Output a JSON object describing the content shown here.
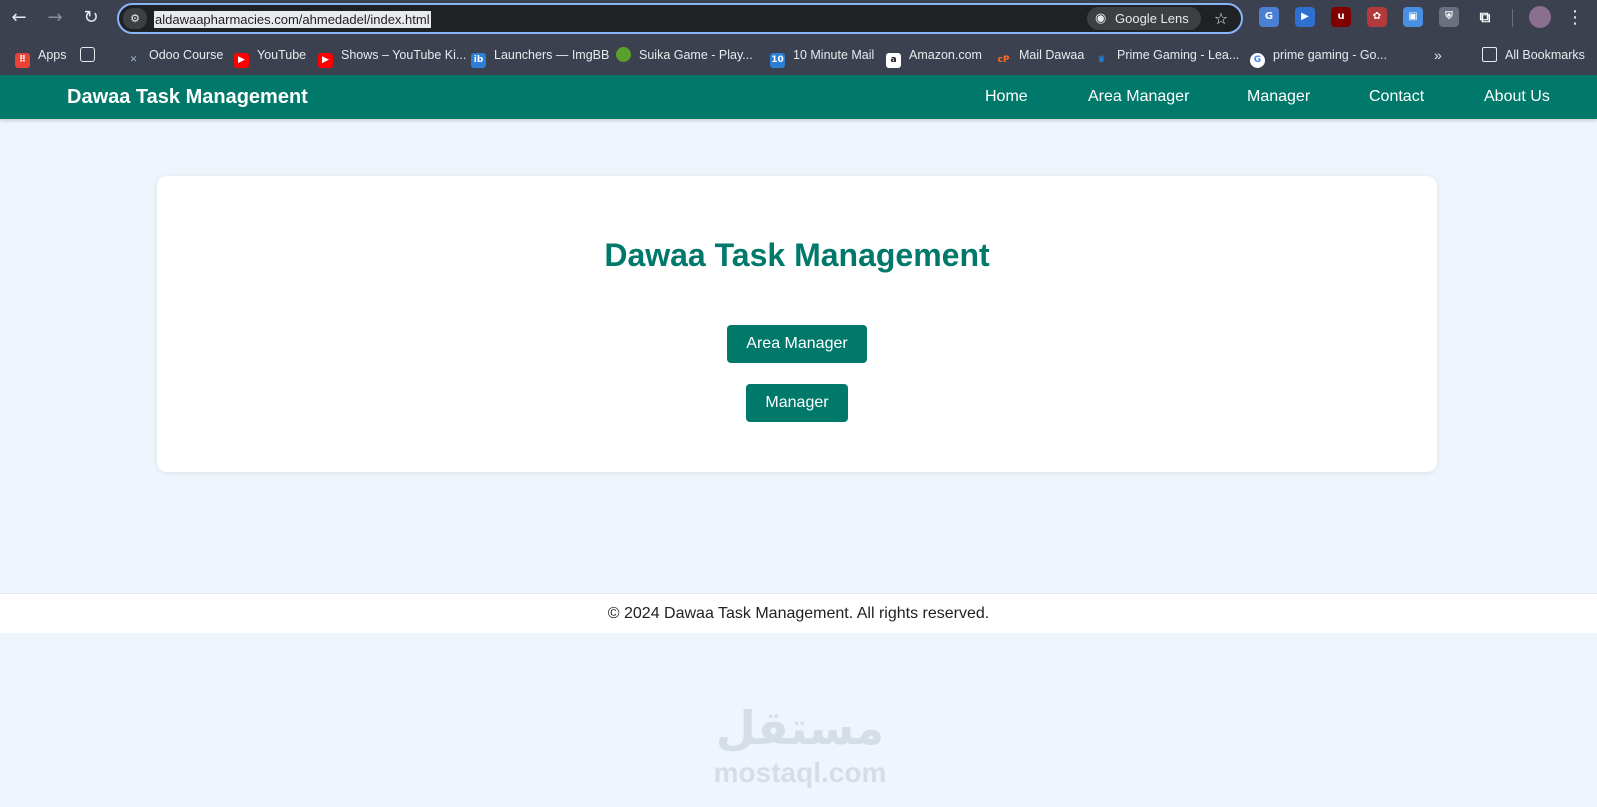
{
  "browser": {
    "url": "aldawaapharmacies.com/ahmedadel/index.html",
    "lens_label": "Google Lens",
    "bookmarks": [
      {
        "label": "Apps",
        "icon": "apps-grid-icon",
        "color": "#e94235"
      },
      {
        "label": "",
        "icon": "tab-groups-icon",
        "color": "#3c4150"
      },
      {
        "label": "Odoo Course",
        "icon": "odoo-icon",
        "color": "#3c4150"
      },
      {
        "label": "YouTube",
        "icon": "youtube-icon",
        "color": "#ff0000"
      },
      {
        "label": "Shows – YouTube Ki...",
        "icon": "youtube-kids-icon",
        "color": "#ff0000"
      },
      {
        "label": "Launchers — ImgBB",
        "icon": "imgbb-icon",
        "color": "#2b7fd6"
      },
      {
        "label": "Suika Game - Play...",
        "icon": "suika-icon",
        "color": "#5aa02c"
      },
      {
        "label": "10 Minute Mail",
        "icon": "ten-minute-mail-icon",
        "color": "#2b7fd6"
      },
      {
        "label": "Amazon.com",
        "icon": "amazon-icon",
        "color": "#ffffff"
      },
      {
        "label": "Mail Dawaa",
        "icon": "cpanel-icon",
        "color": "#ff6c2c"
      },
      {
        "label": "Prime Gaming - Lea...",
        "icon": "crown-icon",
        "color": "#1a98ff"
      },
      {
        "label": "prime gaming - Go...",
        "icon": "google-icon",
        "color": "#ffffff"
      }
    ],
    "all_bookmarks_label": "All Bookmarks"
  },
  "site": {
    "brand": "Dawaa Task Management",
    "nav": [
      "Home",
      "Area Manager",
      "Manager",
      "Contact",
      "About Us"
    ],
    "card_title": "Dawaa Task Management",
    "buttons": [
      "Area Manager",
      "Manager"
    ],
    "footer": "© 2024 Dawaa Task Management. All rights reserved.",
    "accent_color": "#00796b"
  },
  "watermark": {
    "latin": "mostaql.com",
    "arabic": "مستقل"
  }
}
